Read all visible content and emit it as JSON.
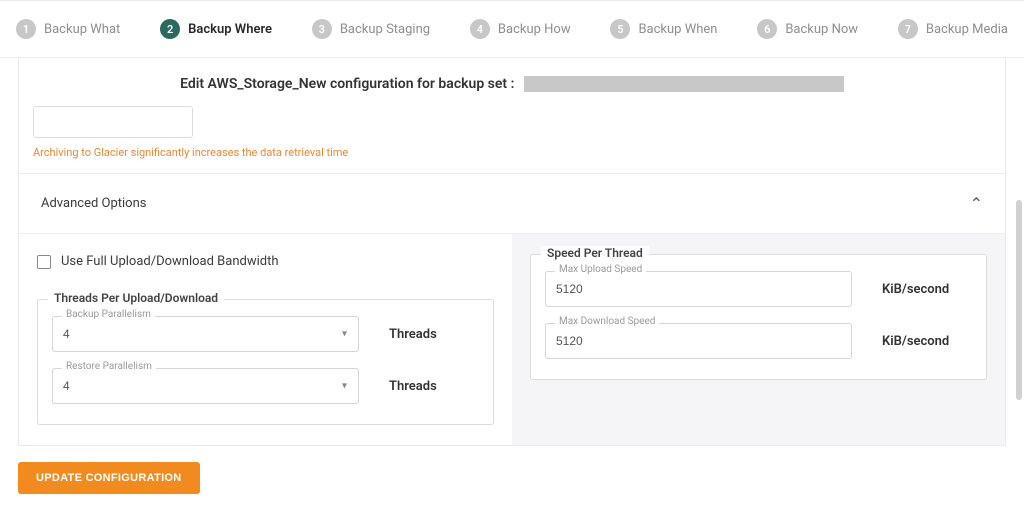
{
  "stepper": [
    {
      "num": "1",
      "label": "Backup What"
    },
    {
      "num": "2",
      "label": "Backup Where"
    },
    {
      "num": "3",
      "label": "Backup Staging"
    },
    {
      "num": "4",
      "label": "Backup How"
    },
    {
      "num": "5",
      "label": "Backup When"
    },
    {
      "num": "6",
      "label": "Backup Now"
    },
    {
      "num": "7",
      "label": "Backup Media"
    }
  ],
  "active_step_index": 1,
  "title_prefix": "Edit AWS_Storage_New configuration for backup set :",
  "glacier_warning": "Archiving to Glacier significantly increases the data retrieval time",
  "advanced_header": "Advanced Options",
  "use_full_bandwidth_label": "Use Full Upload/Download Bandwidth",
  "threads": {
    "legend": "Threads Per Upload/Download",
    "backup_label": "Backup Parallelism",
    "backup_value": "4",
    "restore_label": "Restore Parallelism",
    "restore_value": "4",
    "unit": "Threads"
  },
  "speed": {
    "legend": "Speed Per Thread",
    "upload_label": "Max Upload Speed",
    "upload_value": "5120",
    "download_label": "Max Download Speed",
    "download_value": "5120",
    "unit": "KiB/second"
  },
  "button_label": "UPDATE CONFIGURATION",
  "colors": {
    "accent_active": "#2b6a60",
    "warning": "#e88833",
    "primary_btn": "#f18a1f"
  }
}
